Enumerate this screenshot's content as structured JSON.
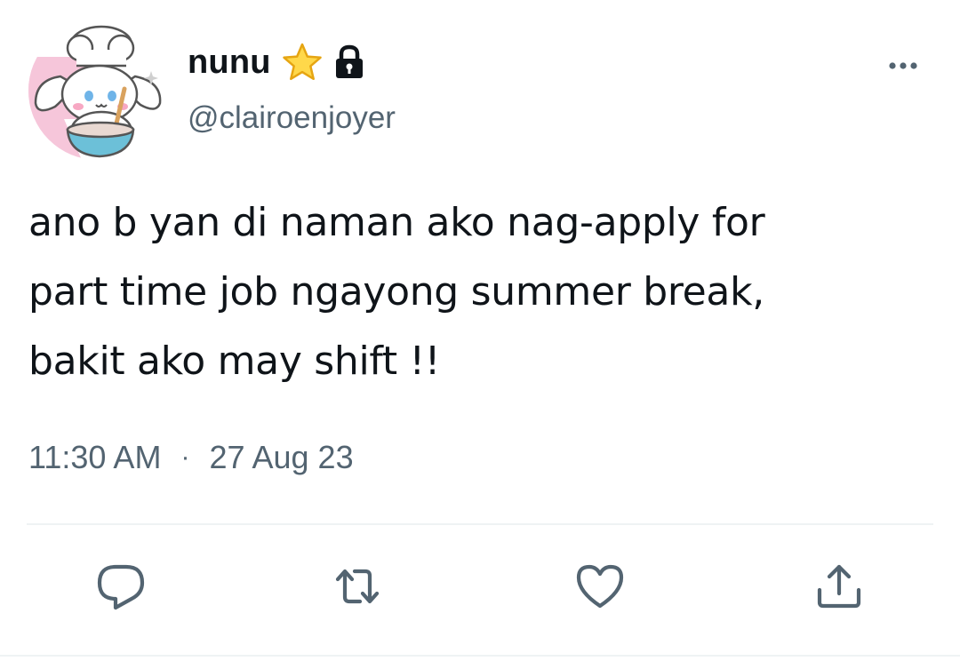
{
  "user": {
    "display_name": "nunu",
    "handle": "@clairoenjoyer",
    "avatar_icon": "chef-bunny-avatar",
    "badges": [
      "star-icon",
      "lock-icon"
    ]
  },
  "tweet": {
    "text": "ano b yan di naman ako nag-apply for\npart time job ngayong summer break,\nbakit ako may shift !!",
    "time": "11:30 AM",
    "separator": "·",
    "date": "27 Aug 23"
  },
  "actions": [
    {
      "name": "reply",
      "icon": "reply-icon"
    },
    {
      "name": "retweet",
      "icon": "retweet-icon"
    },
    {
      "name": "like",
      "icon": "heart-icon"
    },
    {
      "name": "share",
      "icon": "share-icon"
    }
  ],
  "colors": {
    "text_primary": "#0f1419",
    "text_secondary": "#536471",
    "divider": "#eff3f4",
    "avatar_bg": "#f7c9dc"
  }
}
